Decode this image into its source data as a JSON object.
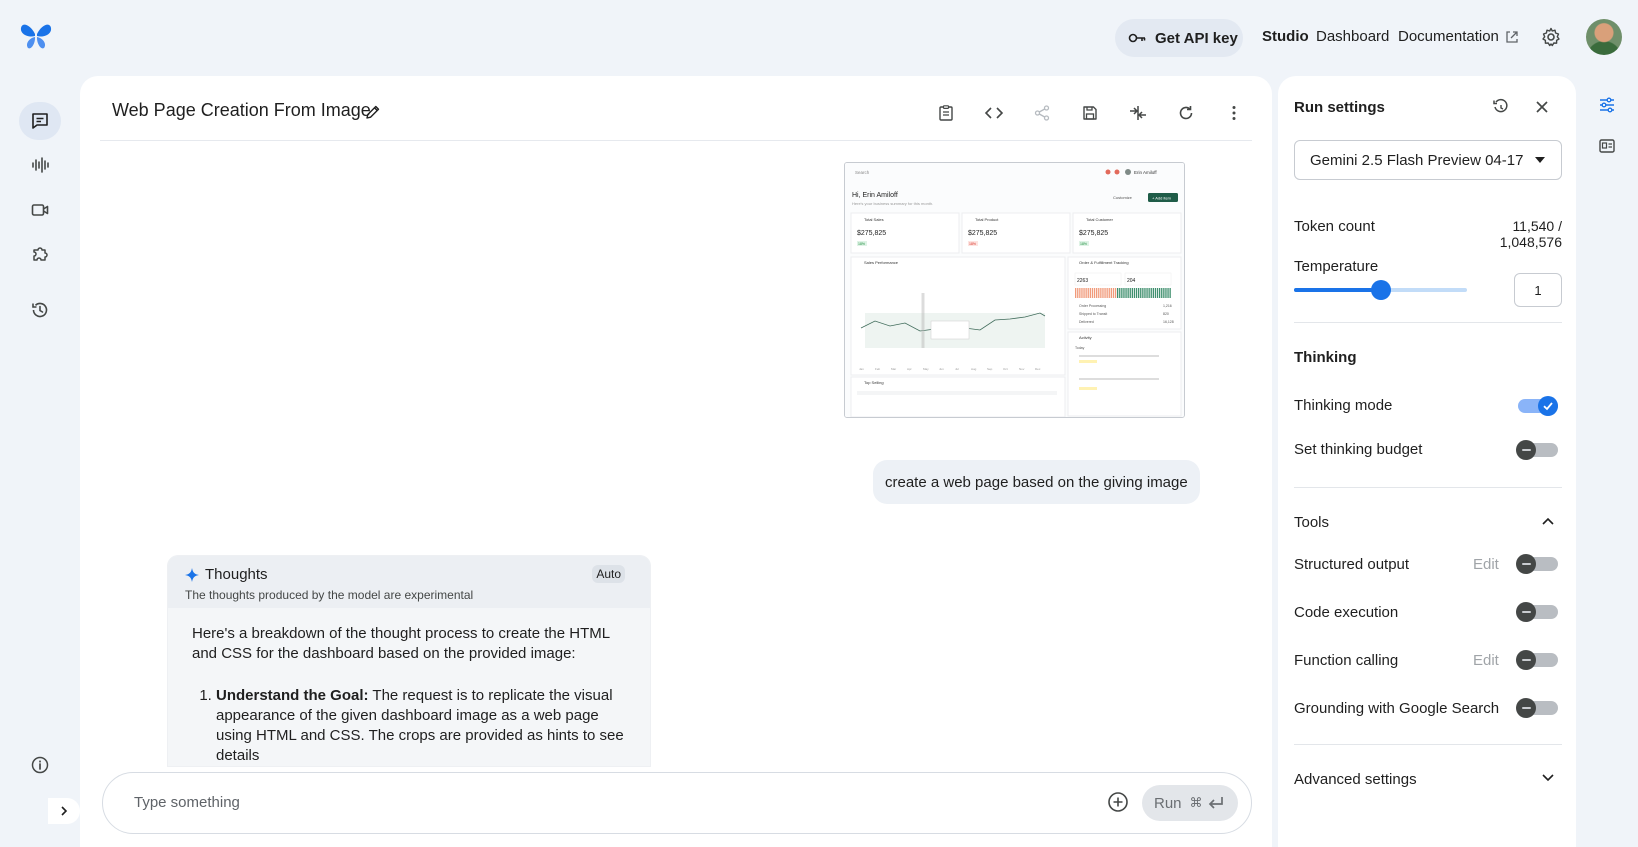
{
  "header": {
    "api_key_label": "Get API key",
    "nav": {
      "studio": "Studio",
      "dashboard": "Dashboard",
      "documentation": "Documentation"
    }
  },
  "rail": {
    "items": [
      "chat-prompt-icon",
      "stream-audio-icon",
      "video-icon",
      "extensions-icon",
      "history-icon"
    ],
    "footer": [
      "info-icon",
      "expand-chevron-icon"
    ]
  },
  "main": {
    "title": "Web Page Creation From Image",
    "toolbar": [
      "notes-icon",
      "code-icon",
      "share-icon",
      "save-icon",
      "compare-icon",
      "refresh-icon",
      "more-icon"
    ],
    "user_message": "create a web page based on the giving image",
    "thoughts": {
      "title": "Thoughts",
      "subtitle": "The thoughts produced by the model are experimental",
      "badge": "Auto",
      "intro": "Here's a breakdown of the thought process to create the HTML and CSS for the dashboard based on the provided image:",
      "step1_title": "Understand the Goal:",
      "step1_text": " The request is to replicate the visual appearance of the given dashboard image as a web page using HTML and CSS. The crops are provided as hints to see details"
    },
    "prompt": {
      "placeholder": "Type something",
      "run_label": "Run",
      "run_shortcut": "⌘"
    }
  },
  "thumbnail": {
    "search": "Search",
    "user": "Erin Amiloff",
    "greeting": "Hi, Erin Amiloff",
    "greeting_sub": "Here's your business summary for this month.",
    "customize": "Customize",
    "add": "+ Add item",
    "kpis": [
      {
        "label": "Total Sales",
        "value": "$275,825",
        "badge": "18%"
      },
      {
        "label": "Total Product",
        "value": "$275,825",
        "badge": "18%"
      },
      {
        "label": "Total Customer",
        "value": "$275,825",
        "badge": "18%"
      }
    ],
    "sales_title": "Sales Performance",
    "orders_title": "Order & Fulfillment Tracking",
    "orders_left": "2263",
    "orders_right": "204",
    "order_rows": [
      {
        "label": "Order Processing",
        "value": "1,216"
      },
      {
        "label": "Shipped to Transit",
        "value": "820"
      },
      {
        "label": "Delivered",
        "value": "16,128"
      }
    ],
    "activity_title": "Activity",
    "activity_today": "Today",
    "top_selling": "Top Selling",
    "months": [
      "Jan",
      "Feb",
      "Mar",
      "Apr",
      "May",
      "Jun",
      "Jul",
      "Aug",
      "Sep",
      "Oct",
      "Nov",
      "Dec"
    ]
  },
  "settings": {
    "title": "Run settings",
    "model": "Gemini 2.5 Flash Preview 04-17",
    "token_label": "Token count",
    "token_value": "11,540 / 1,048,576",
    "temperature_label": "Temperature",
    "temperature_value": "1",
    "temperature_level": 0.5,
    "thinking_heading": "Thinking",
    "thinking_mode": "Thinking mode",
    "thinking_budget": "Set thinking budget",
    "tools_heading": "Tools",
    "structured_output": "Structured output",
    "code_execution": "Code execution",
    "function_calling": "Function calling",
    "grounding": "Grounding with Google Search",
    "edit_label": "Edit",
    "advanced": "Advanced settings"
  },
  "colors": {
    "accent": "#1a73e8",
    "panel_bg": "#f0f4f9",
    "toggle_off": "#444746"
  }
}
